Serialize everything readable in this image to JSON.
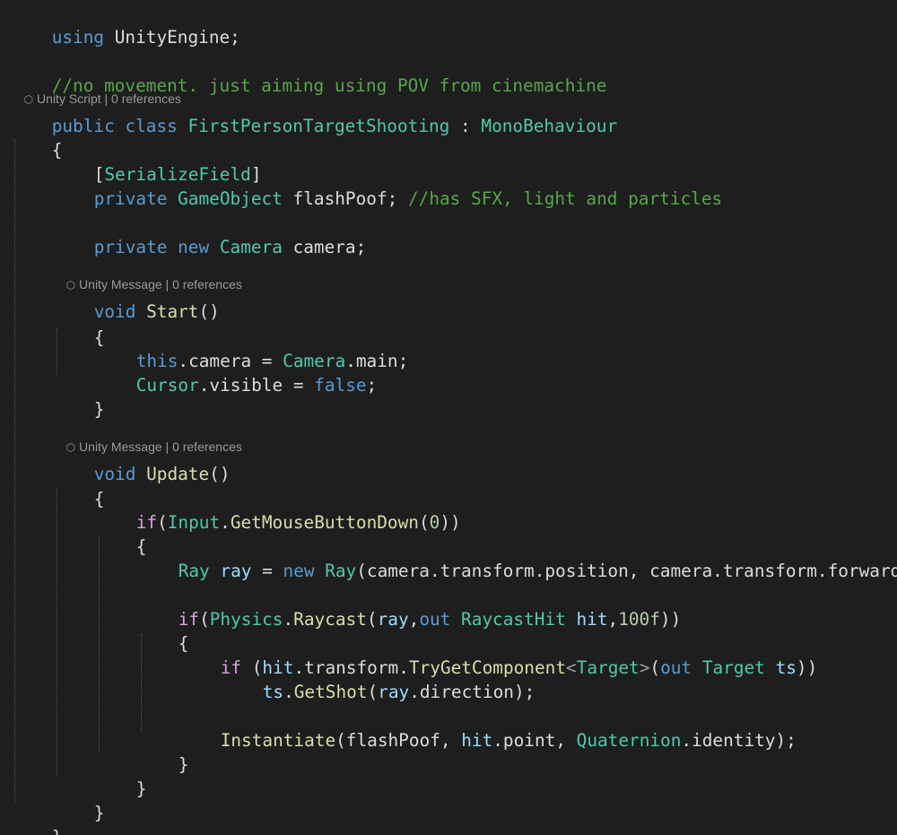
{
  "colors": {
    "background": "#1e1e1e",
    "keyword": "#569cd6",
    "control": "#d8a0df",
    "type": "#4ec9b0",
    "comment": "#57a64a",
    "method": "#dcdcaa",
    "variable": "#9cdcfe",
    "number": "#b5cea8",
    "plain": "#dcdcdc",
    "codelens": "#999999"
  },
  "codelens": {
    "class_lens": {
      "icon": "unity-icon",
      "label": "Unity Script",
      "sep": "|",
      "refs": "0 references"
    },
    "start_lens": {
      "icon": "unity-icon",
      "label": "Unity Message",
      "sep": "|",
      "refs": "0 references"
    },
    "update_lens": {
      "icon": "unity-icon",
      "label": "Unity Message",
      "sep": "|",
      "refs": "0 references"
    }
  },
  "code": {
    "l1": {
      "a": "using",
      "b": " UnityEngine;"
    },
    "l2": {
      "a": "//no movement. just aiming using POV from cinemachine"
    },
    "l3": {
      "a": "public",
      "b": " ",
      "c": "class",
      "d": " ",
      "e": "FirstPersonTargetShooting",
      "f": " : ",
      "g": "MonoBehaviour"
    },
    "l4": {
      "a": "{"
    },
    "l5": {
      "a": "[",
      "b": "SerializeField",
      "c": "]"
    },
    "l6": {
      "a": "private",
      "b": " ",
      "c": "GameObject",
      "d": " flashPoof; ",
      "e": "//has SFX, light and particles"
    },
    "l7": {
      "a": "private",
      "b": " ",
      "c": "new",
      "d": " ",
      "e": "Camera",
      "f": " camera;"
    },
    "l8": {
      "a": "void",
      "b": " ",
      "c": "Start",
      "d": "()"
    },
    "l9": {
      "a": "{"
    },
    "l10": {
      "a": "this",
      "b": ".camera = ",
      "c": "Camera",
      "d": ".main;"
    },
    "l11": {
      "a": "Cursor",
      "b": ".visible = ",
      "c": "false",
      "d": ";"
    },
    "l12": {
      "a": "}"
    },
    "l13": {
      "a": "void",
      "b": " ",
      "c": "Update",
      "d": "()"
    },
    "l14": {
      "a": "{"
    },
    "l15": {
      "a": "if",
      "b": "(",
      "c": "Input",
      "d": ".",
      "e": "GetMouseButtonDown",
      "f": "(",
      "g": "0",
      "h": "))"
    },
    "l16": {
      "a": "{"
    },
    "l17": {
      "a": "Ray",
      "b": " ",
      "c": "ray",
      "d": " = ",
      "e": "new",
      "f": " ",
      "g": "Ray",
      "h": "(camera.transform.position, camera.transform.forward);"
    },
    "l18": {
      "a": "if",
      "b": "(",
      "c": "Physics",
      "d": ".",
      "e": "Raycast",
      "f": "(",
      "g": "ray",
      "h": ",",
      "i": "out",
      "j": " ",
      "k": "RaycastHit",
      "l": " ",
      "m": "hit",
      "n": ",",
      "o": "100f",
      "p": "))"
    },
    "l19": {
      "a": "{"
    },
    "l20": {
      "a": "if",
      "b": " (",
      "c": "hit",
      "d": ".transform.",
      "e": "TryGetComponent",
      "f": "<",
      "g": "Target",
      "h": ">",
      "i": "(",
      "j": "out",
      "k": " ",
      "l": "Target",
      "m": " ",
      "n": "ts",
      "o": "))"
    },
    "l21": {
      "a": "ts",
      "b": ".",
      "c": "GetShot",
      "d": "(",
      "e": "ray",
      "f": ".direction);"
    },
    "l22": {
      "a": "Instantiate",
      "b": "(flashPoof, ",
      "c": "hit",
      "d": ".point, ",
      "e": "Quaternion",
      "f": ".identity);"
    },
    "l23": {
      "a": "}"
    },
    "l24": {
      "a": "}"
    },
    "l25": {
      "a": "}"
    },
    "l26": {
      "a": "}"
    }
  }
}
